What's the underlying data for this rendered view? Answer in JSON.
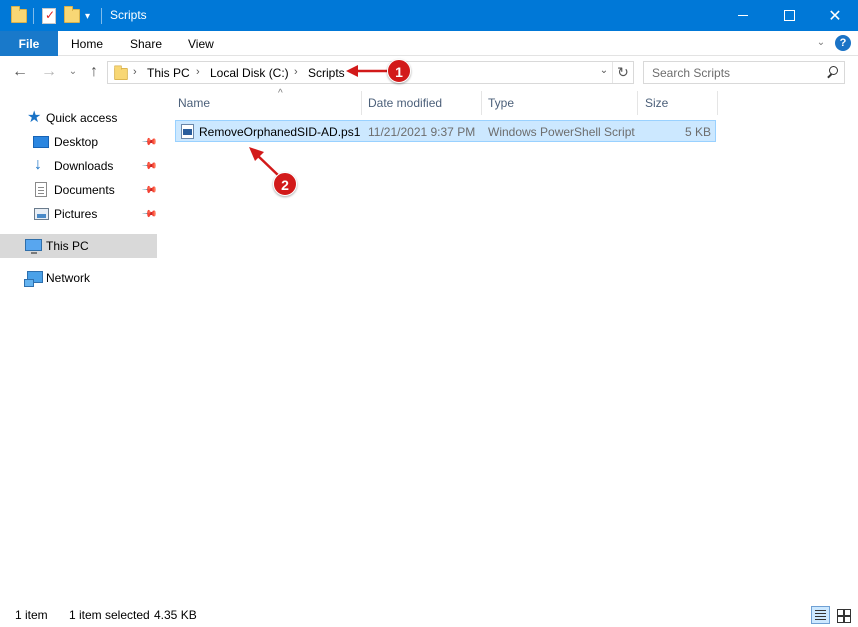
{
  "window": {
    "title": "Scripts",
    "accent": "#0078d7"
  },
  "ribbon": {
    "tabs": [
      "File",
      "Home",
      "Share",
      "View"
    ]
  },
  "address": {
    "crumbs": [
      "This PC",
      "Local Disk (C:)",
      "Scripts"
    ]
  },
  "search": {
    "placeholder": "Search Scripts"
  },
  "sidebar": {
    "items": [
      {
        "label": "Quick access",
        "icon": "star-icon"
      },
      {
        "label": "Desktop",
        "icon": "desktop-icon",
        "pinned": true
      },
      {
        "label": "Downloads",
        "icon": "download-icon",
        "pinned": true
      },
      {
        "label": "Documents",
        "icon": "documents-icon",
        "pinned": true
      },
      {
        "label": "Pictures",
        "icon": "pictures-icon",
        "pinned": true
      },
      {
        "label": "This PC",
        "icon": "computer-icon",
        "selected": true
      },
      {
        "label": "Network",
        "icon": "network-icon"
      }
    ]
  },
  "columns": [
    "Name",
    "Date modified",
    "Type",
    "Size"
  ],
  "files": [
    {
      "name": "RemoveOrphanedSID-AD.ps1",
      "date": "11/21/2021 9:37 PM",
      "type": "Windows PowerShell Script",
      "size": "5 KB",
      "selected": true
    }
  ],
  "annotations": [
    {
      "number": "1",
      "color": "#d21a1a"
    },
    {
      "number": "2",
      "color": "#d21a1a"
    }
  ],
  "status": {
    "count": "1 item",
    "selection": "1 item selected",
    "size": "4.35 KB"
  }
}
